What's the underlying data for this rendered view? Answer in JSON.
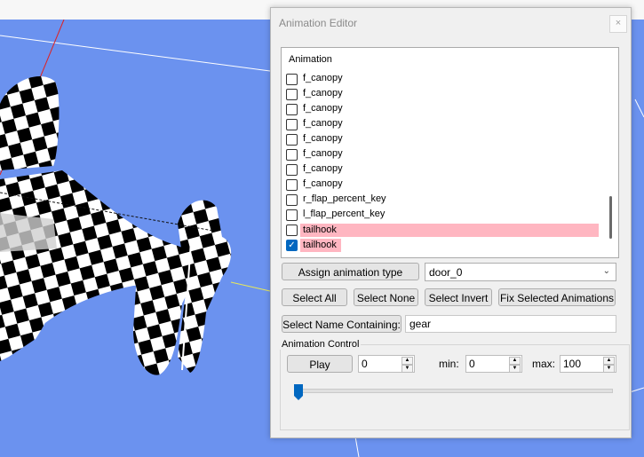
{
  "dialog": {
    "title": "Animation Editor",
    "close_glyph": "×"
  },
  "list": {
    "header": "Animation",
    "items": [
      {
        "label": "f_canopy",
        "checked": false,
        "highlight": false
      },
      {
        "label": "f_canopy",
        "checked": false,
        "highlight": false
      },
      {
        "label": "f_canopy",
        "checked": false,
        "highlight": false
      },
      {
        "label": "f_canopy",
        "checked": false,
        "highlight": false
      },
      {
        "label": "f_canopy",
        "checked": false,
        "highlight": false
      },
      {
        "label": "f_canopy",
        "checked": false,
        "highlight": false
      },
      {
        "label": "f_canopy",
        "checked": false,
        "highlight": false
      },
      {
        "label": "f_canopy",
        "checked": false,
        "highlight": false
      },
      {
        "label": "r_flap_percent_key",
        "checked": false,
        "highlight": false
      },
      {
        "label": "l_flap_percent_key",
        "checked": false,
        "highlight": false
      },
      {
        "label": "tailhook",
        "checked": false,
        "highlight": true
      },
      {
        "label": "tailhook",
        "checked": true,
        "highlight": true
      }
    ]
  },
  "assign": {
    "button_label": "Assign animation type",
    "type_value": "door_0"
  },
  "select_buttons": {
    "all": "Select All",
    "none": "Select None",
    "invert": "Select Invert",
    "fix": "Fix Selected Animations"
  },
  "name_filter": {
    "button_label": "Select Name Containing:",
    "value": "gear"
  },
  "control": {
    "group_label": "Animation Control",
    "play_label": "Play",
    "frame_value": "0",
    "min_label": "min:",
    "min_value": "0",
    "max_label": "max:",
    "max_value": "100",
    "slider_value": 0
  },
  "colors": {
    "viewport_bg": "#6b92ef",
    "highlight": "#ffb6c1",
    "accent": "#0067c0"
  }
}
